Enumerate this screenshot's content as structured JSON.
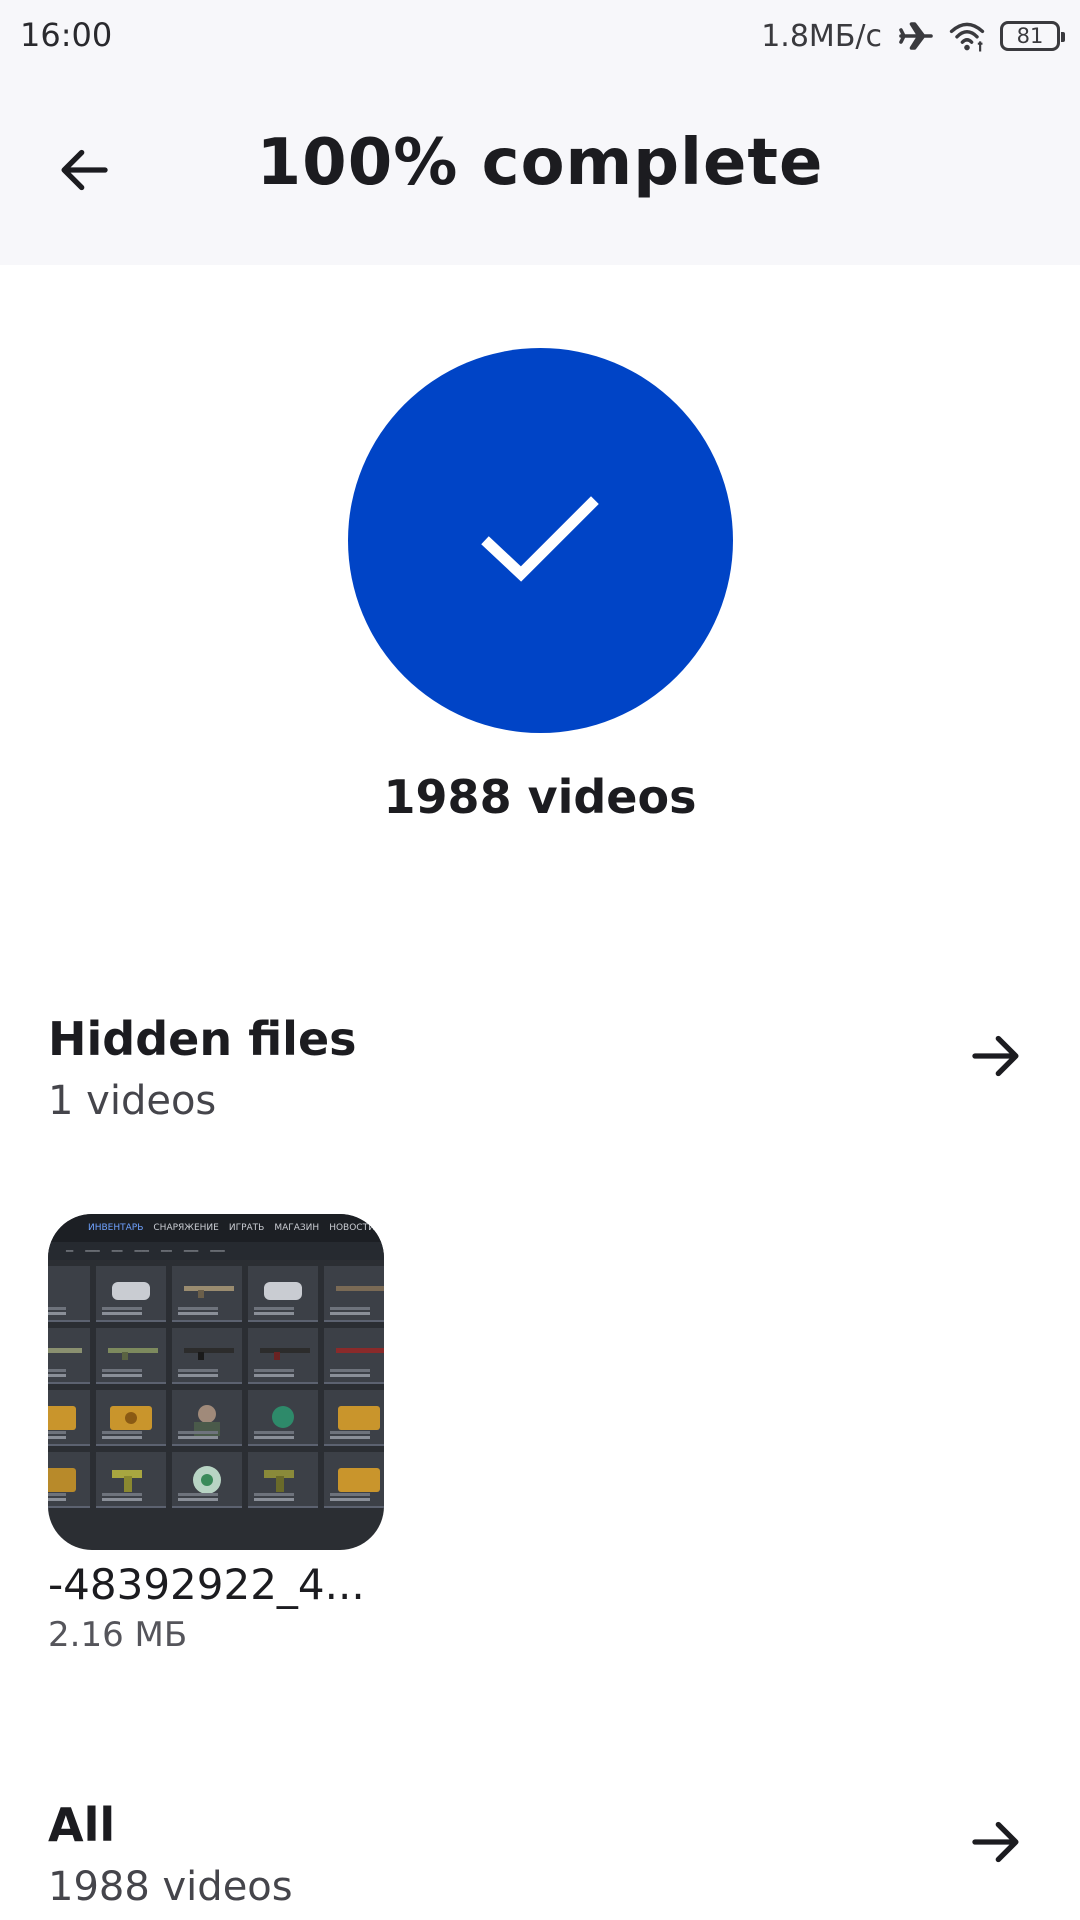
{
  "status_bar": {
    "time": "16:00",
    "speed": "1.8МБ/с",
    "battery": "81",
    "icons": [
      "airplane-icon",
      "wifi-icon",
      "battery-icon"
    ]
  },
  "header": {
    "title": "100% complete",
    "back_icon": "arrow-left-icon"
  },
  "summary": {
    "icon": "checkmark-icon",
    "count_label": "1988 videos",
    "accent_color": "#0044c6"
  },
  "sections": {
    "hidden": {
      "title": "Hidden files",
      "subtitle": "1 videos",
      "arrow_icon": "arrow-right-icon"
    },
    "all": {
      "title": "All",
      "subtitle": "1988 videos",
      "arrow_icon": "arrow-right-icon"
    }
  },
  "hidden_files": [
    {
      "name": "-48392922_4...",
      "size": "2.16 МБ",
      "thumbnail_menu": [
        "ИНВЕНТАРЬ",
        "СНАРЯЖЕНИЕ",
        "ИГРАТЬ",
        "МАГАЗИН",
        "НОВОСТИ"
      ]
    }
  ]
}
